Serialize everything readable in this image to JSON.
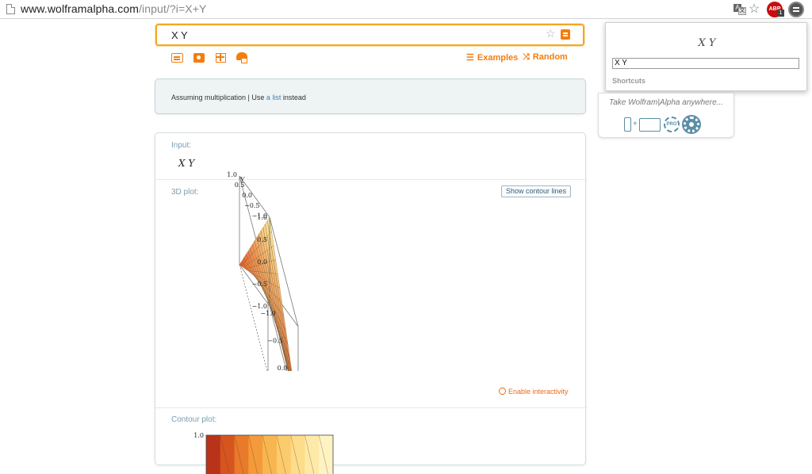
{
  "browser": {
    "url_host": "www.wolframalpha.com",
    "url_path": "/input/?i=X+Y",
    "abp_label": "ABP",
    "abp_count": "1"
  },
  "search": {
    "value": "X Y"
  },
  "toolbar": {
    "examples_label": "Examples",
    "random_label": "Random"
  },
  "assumption": {
    "text_before": "Assuming multiplication | Use ",
    "link_text": "a list",
    "text_after": " instead"
  },
  "pods": {
    "input_title": "Input:",
    "input_math": "X Y",
    "plot3d_title": "3D plot:",
    "contour_button": "Show contour lines",
    "enable_interactivity": "Enable interactivity",
    "contour_title": "Contour plot:"
  },
  "chart_data": [
    {
      "type": "surface",
      "function": "z = X*Y",
      "xlabel": "X",
      "ylabel": "Y",
      "x_ticks": [
        "−1.0",
        "−0.5",
        "0.0",
        "0.5",
        "1.0"
      ],
      "y_ticks": [
        "−1.0",
        "−0.5",
        "0.0",
        "0.5",
        "1.0"
      ],
      "z_ticks": [
        "−1.0",
        "−0.5",
        "0.0",
        "0.5",
        "1.0"
      ],
      "xlim": [
        -1,
        1
      ],
      "ylim": [
        -1,
        1
      ],
      "zlim": [
        -1,
        1
      ]
    },
    {
      "type": "contour",
      "y_ticks": [
        "1.0"
      ]
    }
  ],
  "popup": {
    "math": "X Y",
    "input_value": "X Y",
    "shortcuts_label": "Shortcuts"
  },
  "anywhere": {
    "text": "Take Wolfram|Alpha anywhere...",
    "pro_label": "PRO"
  },
  "colors": {
    "accent": "#f47d0d",
    "link": "#4a7ea8",
    "pod_title": "#7c9db0",
    "surface_low": "#e8521d",
    "surface_high": "#fff3a0"
  }
}
